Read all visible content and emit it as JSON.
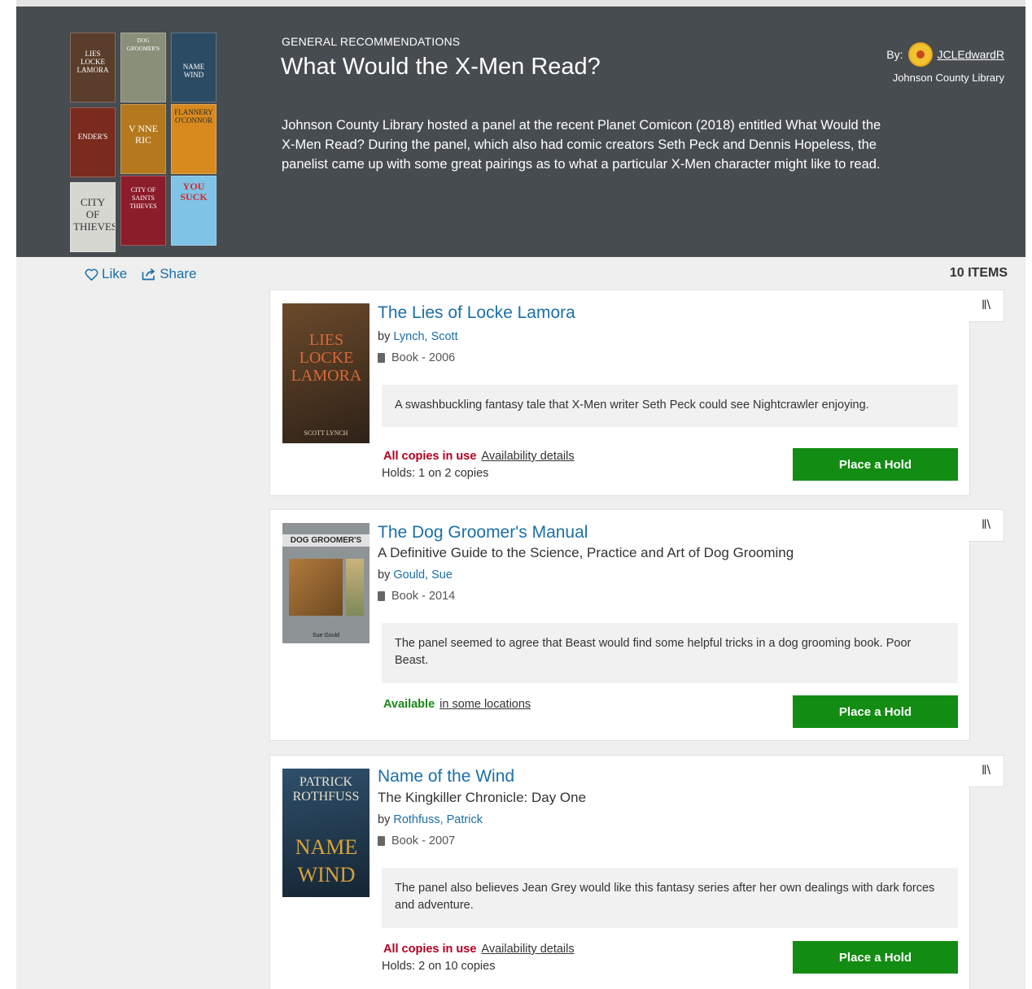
{
  "header": {
    "category": "GENERAL RECOMMENDATIONS",
    "title": "What Would the X-Men Read?",
    "description": "Johnson County Library hosted a panel at the recent Planet Comicon (2018) entitled What Would the X-Men Read? During the panel, which also had comic creators Seth Peck and Dennis Hopeless, the panelist came up with some great pairings as to what a particular X-Men character might like to read.",
    "by_label": "By:",
    "username": "JCLEdwardR",
    "org": "Johnson County Library",
    "mosaic": [
      {
        "text": "LIES LOCKE LAMORA",
        "bg": "#5a3d2a"
      },
      {
        "text": "DOG GROOMER'S",
        "bg": "#8a8f7a"
      },
      {
        "text": "NAME WIND",
        "bg": "#2b4a63"
      },
      {
        "text": "ENDER'S",
        "bg": "#7a2b1e"
      },
      {
        "text": "V NNE RIC",
        "bg": "#b5781d"
      },
      {
        "text": "FLANNERY O'CONNOR",
        "bg": "#d98a1f"
      },
      {
        "text": "CITY OF THIEVES",
        "bg": "#d7d7d2"
      },
      {
        "text": "CITY OF SAINTS THIEVES",
        "bg": "#8b1c2a"
      },
      {
        "text": "YOU SUCK",
        "bg": "#7fc3e6"
      }
    ]
  },
  "actions": {
    "like": "Like",
    "share": "Share"
  },
  "items_count": "10 ITEMS",
  "colors": {
    "hero_bg": "#474c50",
    "link": "#1b6fa7",
    "hold_btn": "#128c12",
    "in_use": "#b00020",
    "available": "#188a18"
  },
  "items": [
    {
      "title": "The Lies of Locke Lamora",
      "subtitle": "",
      "by": "by",
      "author": "Lynch, Scott",
      "format": "Book - 2006",
      "note": "A swashbuckling fantasy tale that X-Men writer Seth Peck could see Nightcrawler enjoying.",
      "status": "All copies in use",
      "status_link": "Availability details",
      "holds": "Holds: 1 on 2 copies",
      "button": "Place a Hold",
      "cover_text": "LIES LOCKE LAMORA",
      "cover_author": "SCOTT LYNCH"
    },
    {
      "title": "The Dog Groomer's Manual",
      "subtitle": "A Definitive Guide to the Science, Practice and Art of Dog Grooming",
      "by": "by",
      "author": "Gould, Sue",
      "format": "Book - 2014",
      "note": "The panel seemed to agree that Beast would find some helpful tricks in a dog grooming book. Poor Beast.",
      "status": "Available",
      "status_link": "in some locations",
      "holds": "",
      "button": "Place a Hold",
      "cover_text": "DOG GROOMER'S",
      "cover_author": "Sue Gould"
    },
    {
      "title": "Name of the Wind",
      "subtitle": "The Kingkiller Chronicle: Day One",
      "by": "by",
      "author": "Rothfuss, Patrick",
      "format": "Book - 2007",
      "note": "The panel also believes Jean Grey would like this fantasy series after her own dealings with dark forces and adventure.",
      "status": "All copies in use",
      "status_link": "Availability details",
      "holds": "Holds: 2 on 10 copies",
      "button": "Place a Hold",
      "cover_text": "NAME WIND",
      "cover_author": "PATRICK ROTHFUSS"
    }
  ]
}
